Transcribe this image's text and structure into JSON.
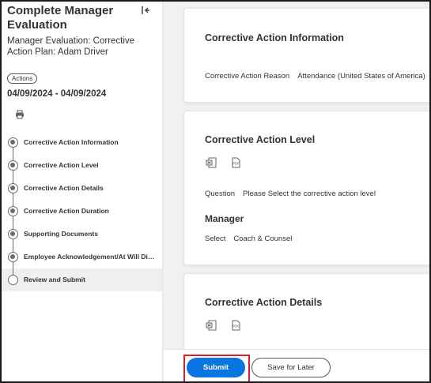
{
  "sidebar": {
    "title": "Complete Manager Evaluation",
    "subtitle": "Manager Evaluation: Corrective Action Plan: Adam Driver",
    "actions_label": "Actions",
    "date_range": "04/09/2024 - 04/09/2024",
    "steps": [
      {
        "label": "Corrective Action Information",
        "completed": true
      },
      {
        "label": "Corrective Action Level",
        "completed": true
      },
      {
        "label": "Corrective Action Details",
        "completed": true
      },
      {
        "label": "Corrective Action Duration",
        "completed": true
      },
      {
        "label": "Supporting Documents",
        "completed": true
      },
      {
        "label": "Employee Acknowledgement/At Will Discl...",
        "completed": true
      },
      {
        "label": "Review and Submit",
        "completed": false,
        "active": true
      }
    ]
  },
  "cards": {
    "info": {
      "title": "Corrective Action Information",
      "reason_label": "Corrective Action Reason",
      "reason_value": "Attendance (United States of America)"
    },
    "level": {
      "title": "Corrective Action Level",
      "question_label": "Question",
      "question_value": "Please Select the corrective action level",
      "manager_heading": "Manager",
      "select_label": "Select",
      "select_value": "Coach & Counsel"
    },
    "details": {
      "title": "Corrective Action Details"
    }
  },
  "icons": {
    "excel": "excel-export-icon",
    "pdf": "pdf-export-icon",
    "print": "print-icon",
    "collapse": "collapse-panel-icon"
  },
  "footer": {
    "submit_label": "Submit",
    "save_later_label": "Save for Later"
  },
  "colors": {
    "primary_button": "#0875e1",
    "highlight_border": "#d9202a",
    "background": "#f0f1f2"
  }
}
